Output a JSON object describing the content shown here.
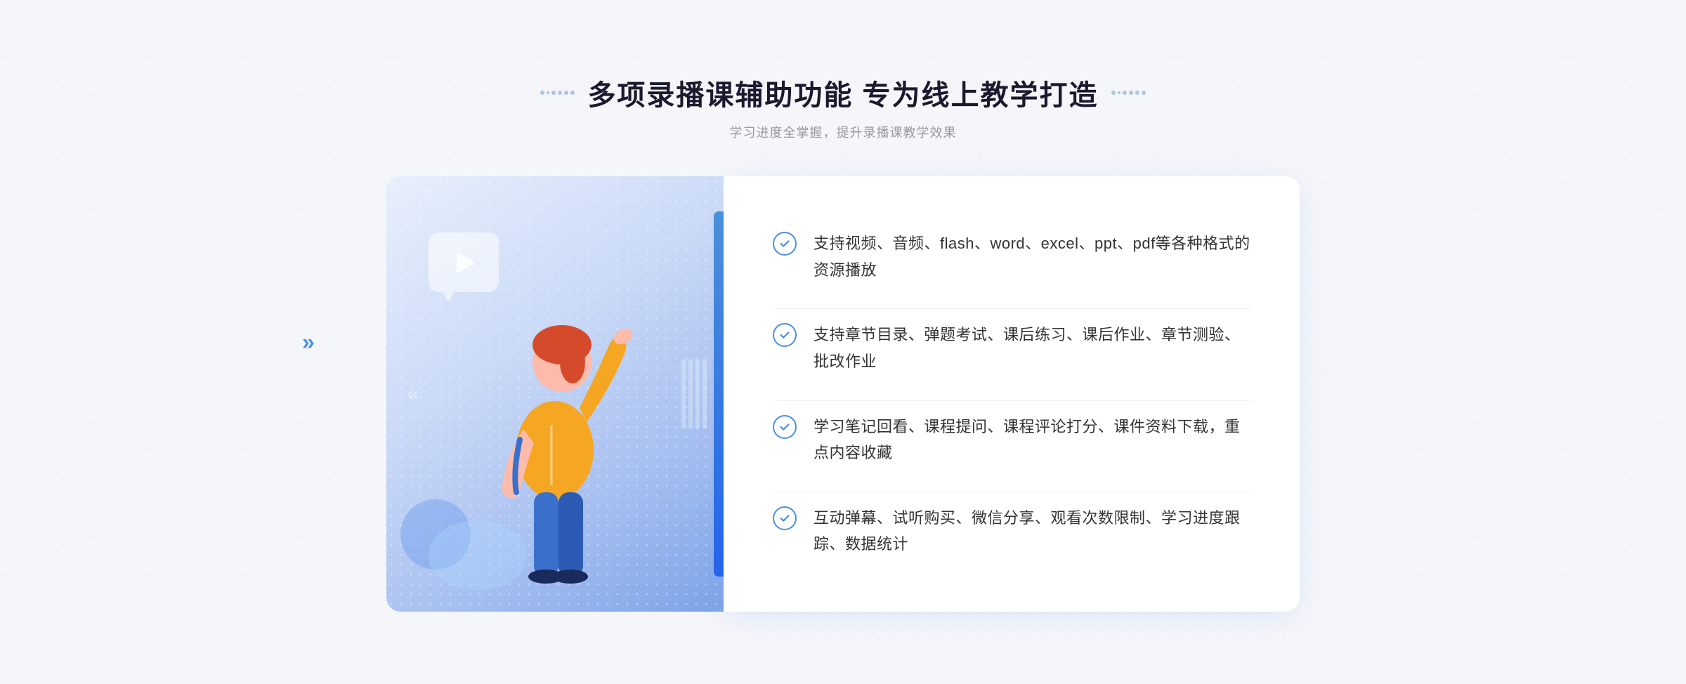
{
  "header": {
    "title": "多项录播课辅助功能 专为线上教学打造",
    "subtitle": "学习进度全掌握，提升录播课教学效果",
    "title_dots_left": "decoration",
    "title_dots_right": "decoration"
  },
  "features": [
    {
      "id": 1,
      "text": "支持视频、音频、flash、word、excel、ppt、pdf等各种格式的资源播放"
    },
    {
      "id": 2,
      "text": "支持章节目录、弹题考试、课后练习、课后作业、章节测验、批改作业"
    },
    {
      "id": 3,
      "text": "学习笔记回看、课程提问、课程评论打分、课件资料下载，重点内容收藏"
    },
    {
      "id": 4,
      "text": "互动弹幕、试听购买、微信分享、观看次数限制、学习进度跟踪、数据统计"
    }
  ],
  "colors": {
    "title": "#1a1a2e",
    "subtitle": "#999999",
    "accent_blue": "#4a90e2",
    "feature_text": "#333333",
    "panel_bg": "#ffffff",
    "illustration_gradient_start": "#e8effc",
    "illustration_gradient_end": "#7ba3e8"
  },
  "icons": {
    "check": "check-circle-icon",
    "play": "play-icon",
    "chevrons_left": "«"
  }
}
